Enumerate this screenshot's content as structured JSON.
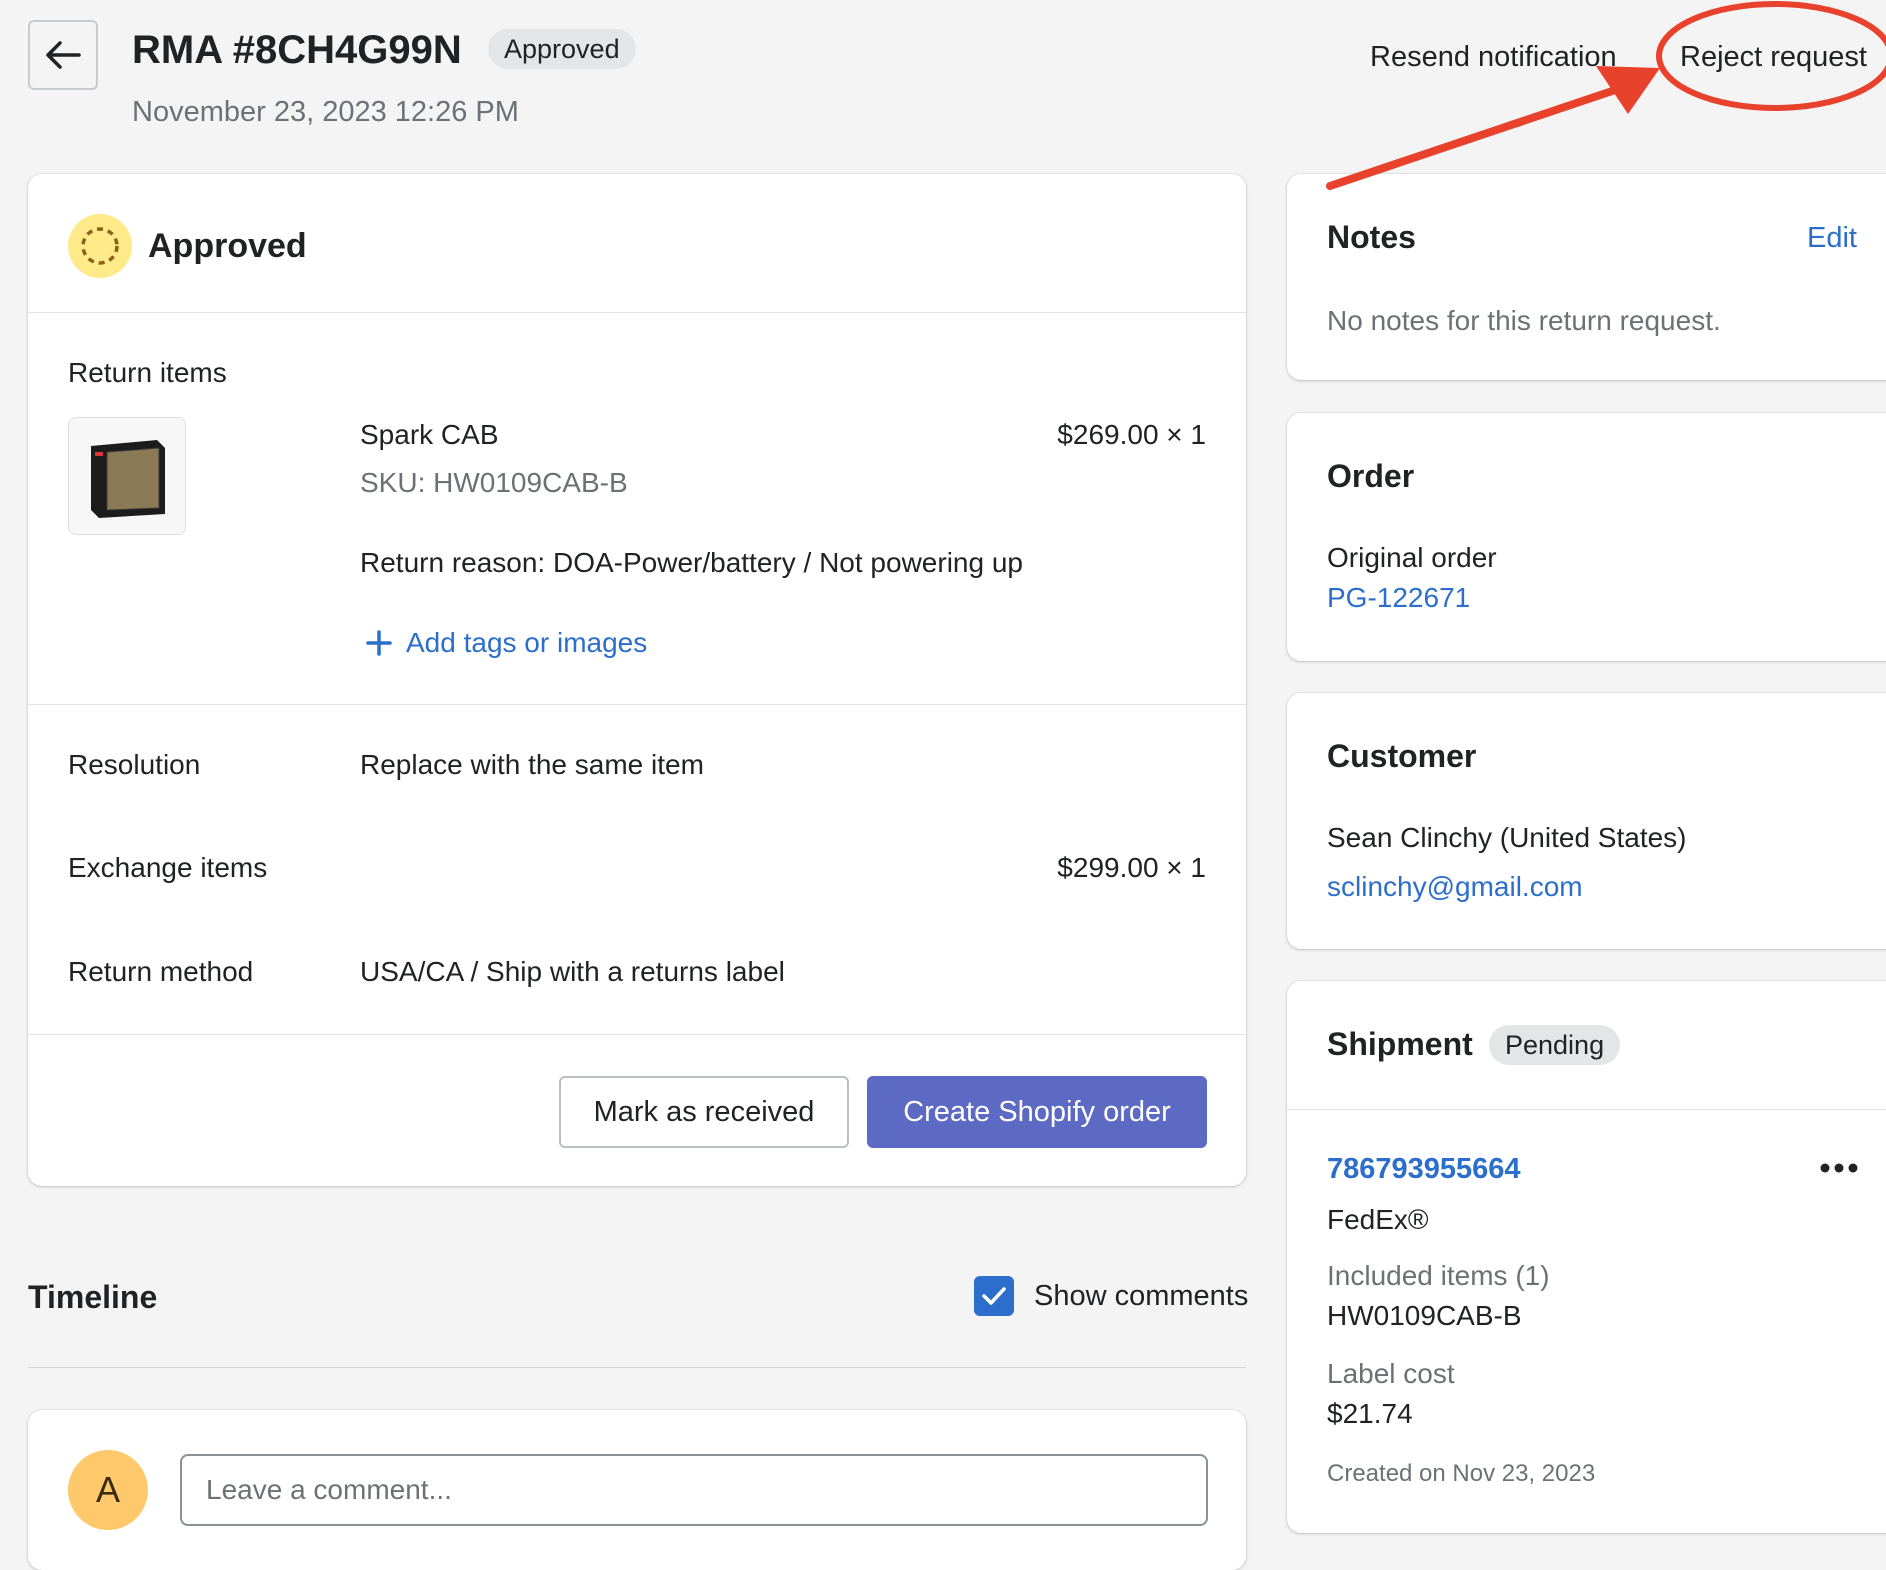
{
  "header": {
    "title": "RMA #8CH4G99N",
    "status_badge": "Approved",
    "date": "November 23, 2023 12:26 PM",
    "resend_label": "Resend notification",
    "reject_label": "Reject request"
  },
  "main_card": {
    "status": "Approved",
    "return_items_label": "Return items",
    "item": {
      "name": "Spark CAB",
      "sku": "SKU: HW0109CAB-B",
      "price": "$269.00 × 1",
      "reason": "Return reason: DOA-Power/battery / Not powering up",
      "add_tags": "Add tags or images"
    },
    "resolution_label": "Resolution",
    "resolution_value": "Replace with the same item",
    "exchange_label": "Exchange items",
    "exchange_price": "$299.00 × 1",
    "method_label": "Return method",
    "method_value": "USA/CA / Ship with a returns label",
    "mark_received": "Mark as received",
    "create_order": "Create Shopify order"
  },
  "timeline": {
    "title": "Timeline",
    "show_comments": "Show comments",
    "avatar_initial": "A",
    "comment_placeholder": "Leave a comment..."
  },
  "notes": {
    "title": "Notes",
    "edit": "Edit",
    "body": "No notes for this return request."
  },
  "order": {
    "title": "Order",
    "original_label": "Original order",
    "original_value": "PG-122671"
  },
  "customer": {
    "title": "Customer",
    "name": "Sean Clinchy (United States)",
    "email": "sclinchy@gmail.com"
  },
  "shipment": {
    "title": "Shipment",
    "badge": "Pending",
    "tracking": "786793955664",
    "carrier": "FedEx®",
    "included_label": "Included items (1)",
    "included_value": "HW0109CAB-B",
    "cost_label": "Label cost",
    "cost_value": "$21.74",
    "created": "Created on Nov 23, 2023"
  },
  "colors": {
    "primary": "#5c6ac4",
    "link": "#2c6ecb",
    "annotation": "#e8412c",
    "status_yellow": "#ffea8a",
    "avatar": "#ffc96b"
  },
  "icons": [
    "back-arrow-icon",
    "progress-circle-icon",
    "plus-icon",
    "checkbox-checked-icon",
    "more-horizontal-icon"
  ]
}
